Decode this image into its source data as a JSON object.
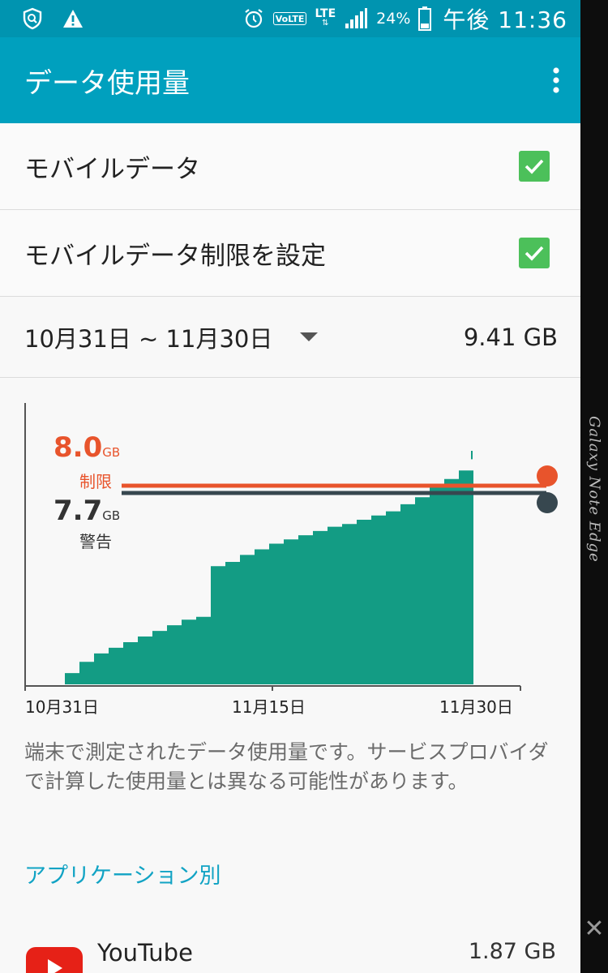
{
  "status_bar": {
    "battery": "24%",
    "network": "LTE",
    "volte": "VoLTE",
    "time": "午後 11:36",
    "icons": [
      "shield-icon",
      "warning-icon",
      "alarm-icon",
      "volte-icon",
      "lte-icon",
      "signal-icon",
      "battery-icon"
    ]
  },
  "toolbar": {
    "title": "データ使用量"
  },
  "settings": {
    "mobile_data": {
      "label": "モバイルデータ",
      "checked": true
    },
    "data_limit": {
      "label": "モバイルデータ制限を設定",
      "checked": true
    }
  },
  "period": {
    "range": "10月31日 ~ 11月30日",
    "total": "9.41 GB"
  },
  "chart": {
    "limit": {
      "value": "8.0",
      "unit": "GB",
      "name": "制限"
    },
    "warning": {
      "value": "7.7",
      "unit": "GB",
      "name": "警告"
    },
    "x_labels": [
      "10月31日",
      "11月15日",
      "11月30日"
    ]
  },
  "chart_data": {
    "type": "area",
    "title": "",
    "xlabel": "",
    "ylabel": "",
    "x_labels": [
      "10月31日",
      "11月15日",
      "11月30日"
    ],
    "series": [
      {
        "x": [
          0,
          1,
          2,
          3,
          4,
          5,
          6,
          7,
          8,
          9,
          10,
          11,
          12,
          13,
          14,
          15,
          16,
          17,
          18,
          19,
          20,
          21,
          22,
          23,
          24,
          25,
          26,
          27,
          28,
          29
        ],
        "values": [
          0.0,
          0.4,
          0.8,
          1.1,
          1.3,
          1.5,
          1.7,
          1.9,
          2.1,
          2.3,
          2.4,
          4.2,
          4.35,
          4.6,
          4.8,
          5.0,
          5.15,
          5.3,
          5.45,
          5.6,
          5.7,
          5.85,
          6.0,
          6.15,
          6.4,
          6.65,
          7.0,
          7.3,
          7.6,
          8.0
        ]
      }
    ],
    "ylim": [
      0,
      10
    ],
    "limit_line": 8.0,
    "warning_line": 7.7,
    "colors": {
      "area": "#139c84",
      "limit": "#e8542c",
      "warning": "#37474f"
    },
    "grid": false
  },
  "note": "端末で測定されたデータ使用量です。サービスプロバイダで計算した使用量とは異なる可能性があります。",
  "section_header": "アプリケーション別",
  "apps": [
    {
      "name": "YouTube",
      "size": "1.87 GB",
      "icon": "youtube-icon"
    }
  ],
  "edge": {
    "label": "Galaxy Note Edge"
  },
  "colors": {
    "statusbar": "#0094b0",
    "toolbar": "#00a0be",
    "accent": "#11a3c4",
    "check": "#4cc05a"
  }
}
